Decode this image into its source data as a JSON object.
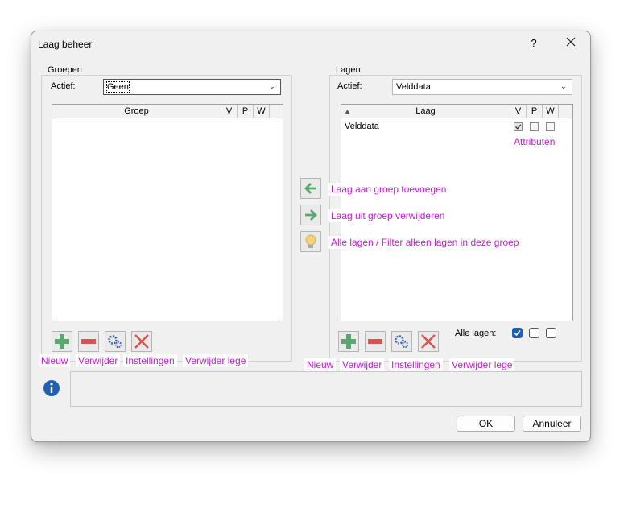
{
  "window": {
    "title": "Laag beheer",
    "help_icon": "question-mark-icon",
    "close_icon": "close-icon"
  },
  "groups_panel": {
    "legend": "Groepen",
    "active_label": "Actief:",
    "active_value": "Geen",
    "columns": [
      "Groep",
      "V",
      "P",
      "W"
    ],
    "rows": []
  },
  "layers_panel": {
    "legend": "Lagen",
    "active_label": "Actief:",
    "active_value": "Velddata",
    "columns": [
      "Laag",
      "V",
      "P",
      "W"
    ],
    "rows": [
      {
        "name": "Velddata",
        "V": true,
        "P": false,
        "W": false
      }
    ],
    "all_layers_label": "Alle lagen:",
    "all_layers": {
      "V": true,
      "P": false,
      "W": false
    }
  },
  "annotations": {
    "attributes": "Attributen",
    "add_to_group": "Laag aan groep toevoegen",
    "remove_from_group": "Laag uit groep verwijderen",
    "filter": "Alle lagen / Filter alleen lagen in deze groep",
    "groups_new": "Nieuw",
    "groups_delete": "Verwijder",
    "groups_settings": "Instellingen",
    "groups_delete_empty": "Verwijder lege",
    "layers_new": "Nieuw",
    "layers_delete": "Verwijder",
    "layers_settings": "Instellingen",
    "layers_delete_empty": "Verwijder lege"
  },
  "info": {
    "icon": "info-icon",
    "text": ""
  },
  "buttons": {
    "ok": "OK",
    "cancel": "Annuleer"
  },
  "colors": {
    "annotation": "#c020d0",
    "accent_blue": "#1f5fb4",
    "green_icon": "#5aa870",
    "red_icon": "#d9534f"
  }
}
